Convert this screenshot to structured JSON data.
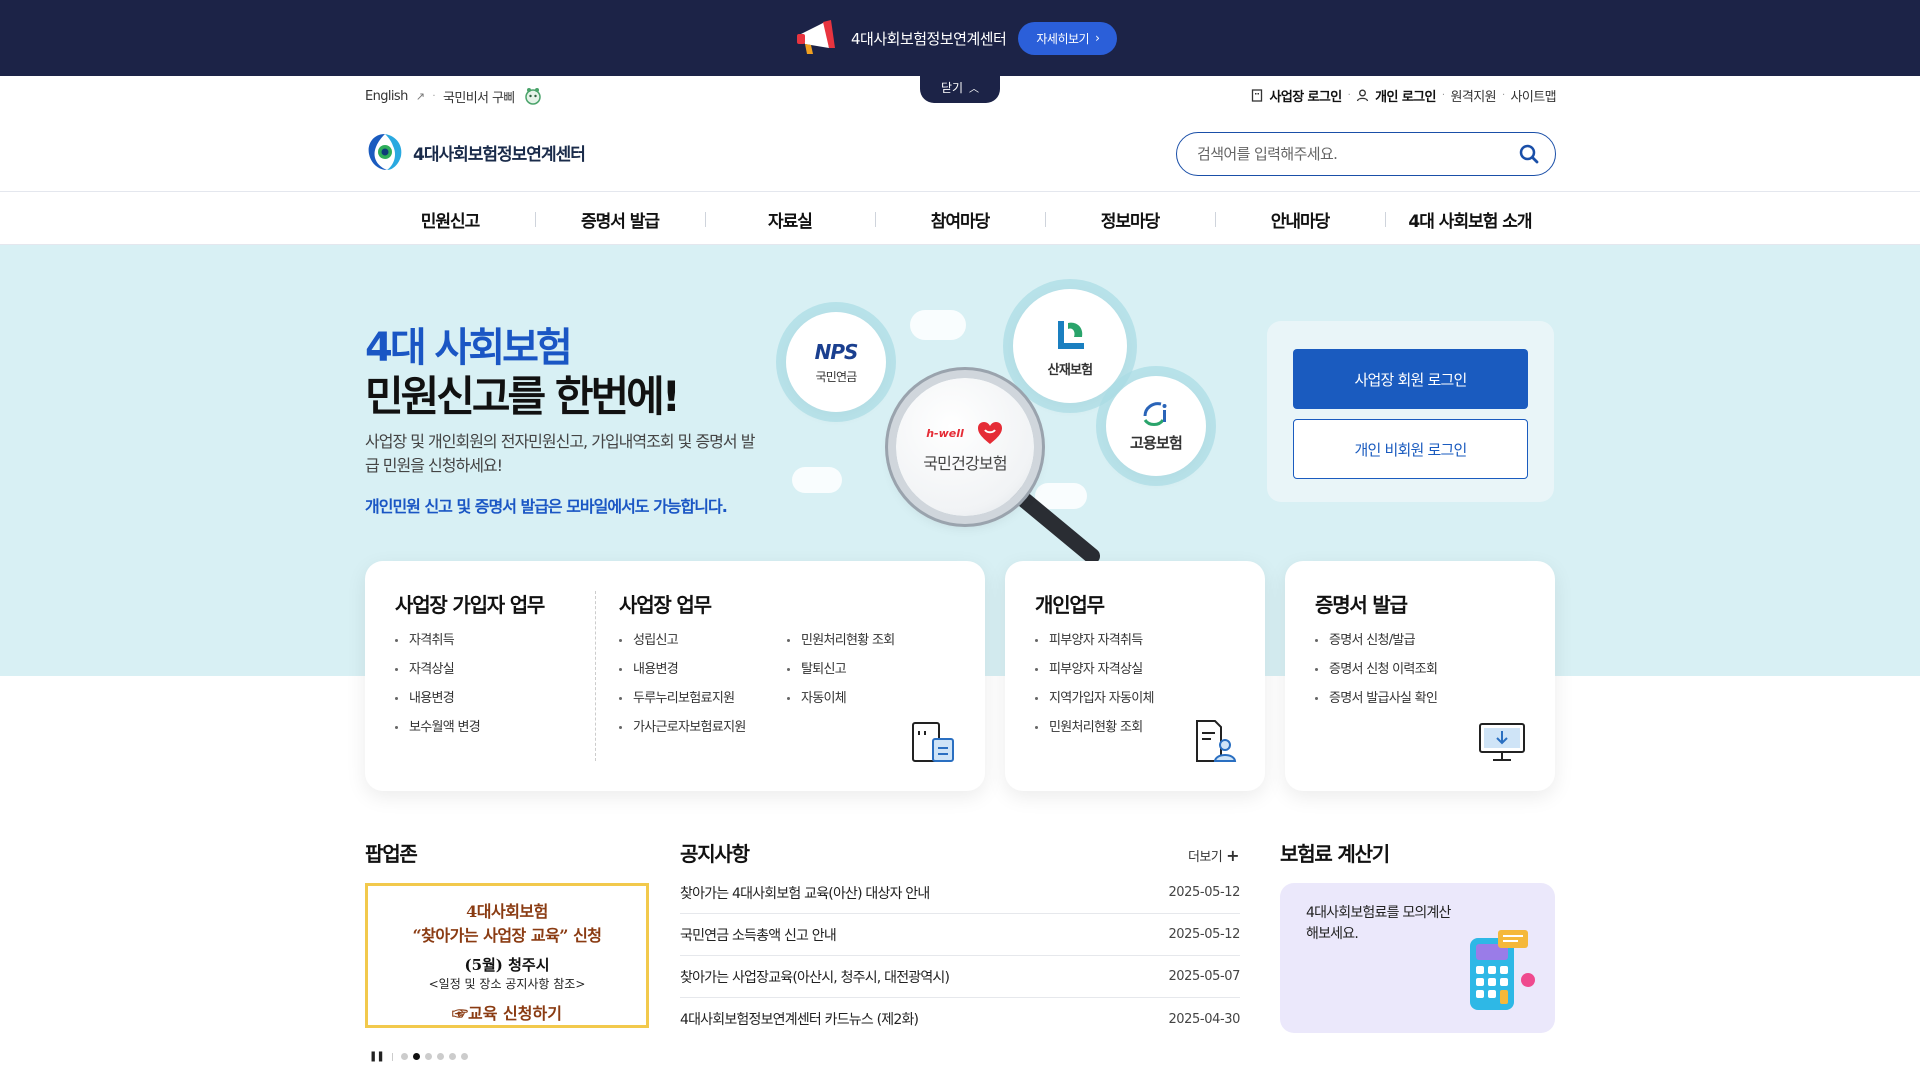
{
  "promo": {
    "text": "4대사회보험정보연계센터",
    "button": "자세히보기",
    "close": "닫기"
  },
  "util": {
    "english": "English",
    "secretary": "국민비서 구삐",
    "biz_login": "사업장 로그인",
    "ind_login": "개인 로그인",
    "remote": "원격지원",
    "sitemap": "사이트맵"
  },
  "logo": {
    "name": "4대사회보험정보연계센터"
  },
  "search": {
    "placeholder": "검색어를 입력해주세요."
  },
  "gnb": [
    "민원신고",
    "증명서 발급",
    "자료실",
    "참여마당",
    "정보마당",
    "안내마당",
    "4대 사회보험 소개"
  ],
  "hero": {
    "title1": "4대 사회보험",
    "title2": "민원신고를 한번에!",
    "desc": "사업장 및 개인회원의 전자민원신고, 가입내역조회 및 증명서 발급 민원을 신청하세요!",
    "mobile": "개인민원 신고 및 증명서 발급은 모바일에서도 가능합니다."
  },
  "circles": {
    "nps_logo": "NPS",
    "nps": "국민연금",
    "nhis_logo": "h-well",
    "nhis": "국민건강보험",
    "ind": "산재보험",
    "emp": "고용보험"
  },
  "login": {
    "biz": "사업장 회원 로그인",
    "ind": "개인 비회원 로그인"
  },
  "cards": {
    "biz_member": {
      "title": "사업장 가입자 업무",
      "items": [
        "자격취득",
        "자격상실",
        "내용변경",
        "보수월액 변경"
      ]
    },
    "biz": {
      "title": "사업장 업무",
      "col1": [
        "성립신고",
        "내용변경",
        "두루누리보험료지원",
        "가사근로자보험료지원"
      ],
      "col2": [
        "민원처리현황 조회",
        "탈퇴신고",
        "자동이체"
      ]
    },
    "personal": {
      "title": "개인업무",
      "items": [
        "피부양자 자격취득",
        "피부양자 자격상실",
        "지역가입자 자동이체",
        "민원처리현황 조회"
      ]
    },
    "cert": {
      "title": "증명서 발급",
      "items": [
        "증명서 신청/발급",
        "증명서 신청 이력조회",
        "증명서 발급사실 확인"
      ]
    }
  },
  "popup": {
    "title": "팝업존",
    "banner": {
      "l1": "4대사회보험",
      "l2": "“찾아가는 사업장 교육” 신청",
      "l3": "(5월) 청주시",
      "l4": "<일정 및 장소 공지사항 참조>",
      "l5": "☞교육 신청하기"
    }
  },
  "notice": {
    "title": "공지사항",
    "more": "더보기",
    "items": [
      {
        "title": "찾아가는 4대사회보험 교육(아산) 대상자 안내",
        "date": "2025-05-12"
      },
      {
        "title": "국민연금 소득총액 신고 안내",
        "date": "2025-05-12"
      },
      {
        "title": "찾아가는 사업장교육(아산시, 청주시, 대전광역시)",
        "date": "2025-05-07"
      },
      {
        "title": "4대사회보험정보연계센터 카드뉴스 (제2화)",
        "date": "2025-04-30"
      }
    ]
  },
  "calc": {
    "title": "보험료 계산기",
    "text": "4대사회보험료를 모의계산 해보세요."
  },
  "colors": {
    "navy": "#1c2347",
    "blue": "#1a5bbf",
    "hero_bg": "#d8f0f4",
    "calc_bg": "#ebe8fb"
  }
}
